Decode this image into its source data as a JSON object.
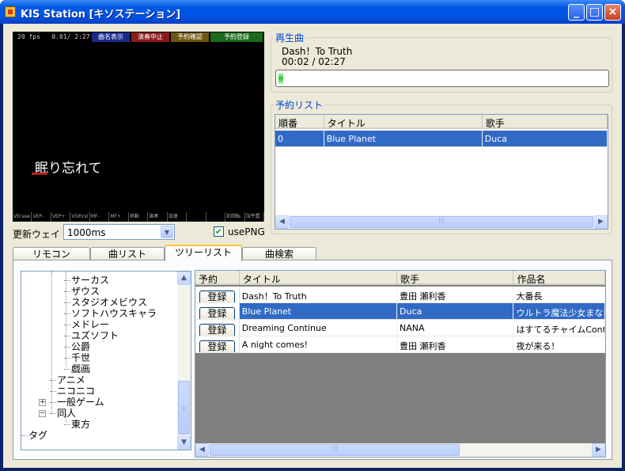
{
  "window": {
    "title": "KIS Station [キソステーション]",
    "buttons": {
      "minimize": "_",
      "maximize": "□",
      "close": "×"
    }
  },
  "video": {
    "fps": "20 fps",
    "time": "0.01/ 2:27",
    "buttons": [
      {
        "label": "曲名表示",
        "color": "#1a2a8c"
      },
      {
        "label": "演奏中止",
        "color": "#8c1a1a"
      },
      {
        "label": "予約確認",
        "color": "#6b5510"
      },
      {
        "label": "予約登録",
        "color": "#1a6b1a"
      }
    ],
    "lyric": "眠り忘れて",
    "strip": [
      "VErase",
      "VEP-",
      "VEP+",
      "VGFirst",
      "MF-",
      "MF+",
      "移動",
      "演奏",
      "加速",
      "",
      "",
      "前回転",
      "加平置"
    ]
  },
  "controls": {
    "wait_label": "更新ウェイト",
    "wait_value": "1000ms",
    "usepng_label": "usePNG",
    "usepng_checked": true
  },
  "now_playing": {
    "title": "再生曲",
    "song": "Dash！To Truth",
    "time": "00:02 / 02:27",
    "progress": 0.014
  },
  "reserve": {
    "title": "予約リスト",
    "columns": [
      "順番",
      "タイトル",
      "歌手"
    ],
    "rows": [
      {
        "order": "0",
        "title": "Blue Planet",
        "artist": "Duca",
        "selected": true
      }
    ]
  },
  "tabs": [
    {
      "label": "リモコン",
      "active": false
    },
    {
      "label": "曲リスト",
      "active": false
    },
    {
      "label": "ツリーリスト",
      "active": true
    },
    {
      "label": "曲検索",
      "active": false
    }
  ],
  "tree": {
    "items": [
      {
        "label": "サーカス",
        "level": 3
      },
      {
        "label": "ザウス",
        "level": 3
      },
      {
        "label": "スタジオメビウス",
        "level": 3
      },
      {
        "label": "ソフトハウスキャラ",
        "level": 3
      },
      {
        "label": "メドレー",
        "level": 3
      },
      {
        "label": "ユズソフト",
        "level": 3
      },
      {
        "label": "公爵",
        "level": 3
      },
      {
        "label": "千世",
        "level": 3
      },
      {
        "label": "戯画",
        "level": 3
      },
      {
        "label": "アニメ",
        "level": 2
      },
      {
        "label": "ニコニコ",
        "level": 2
      },
      {
        "label": "一般ゲーム",
        "level": 2,
        "expander": "+"
      },
      {
        "label": "同人",
        "level": 2,
        "expander": "−"
      },
      {
        "label": "東方",
        "level": 3
      },
      {
        "label": "タグ",
        "level": 1,
        "expander": "+"
      }
    ]
  },
  "songs": {
    "columns": [
      "予約",
      "タイトル",
      "歌手",
      "作品名"
    ],
    "register_label": "登録",
    "rows": [
      {
        "title": "Dash！To Truth",
        "artist": "豊田 瀬利香",
        "work": "大番長",
        "selected": false
      },
      {
        "title": "Blue Planet",
        "artist": "Duca",
        "work": "ウルトラ魔法少女まなな",
        "selected": true
      },
      {
        "title": "Dreaming Continue",
        "artist": "NANA",
        "work": "はすてるチャイムContinue",
        "selected": false
      },
      {
        "title": "A night comes!",
        "artist": "豊田 瀬利香",
        "work": "夜が来る！",
        "selected": false
      }
    ]
  }
}
